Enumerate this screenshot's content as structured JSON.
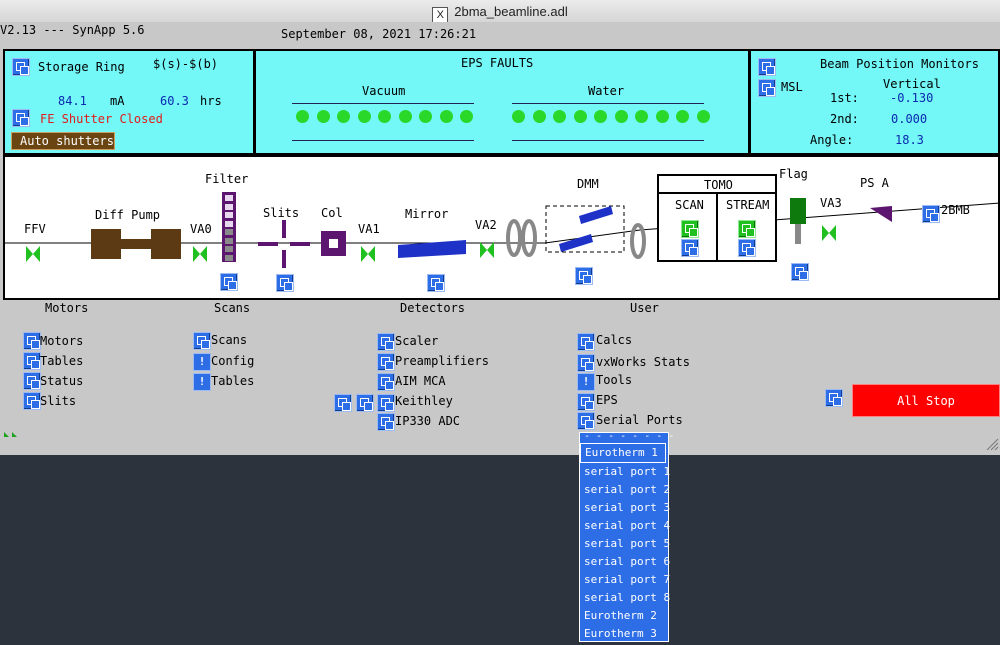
{
  "window": {
    "title": "2bma_beamline.adl"
  },
  "header": {
    "version": "V2.13 --- SynApp 5.6",
    "datetime": "September 08, 2021 17:26:21"
  },
  "storage_ring": {
    "label": "Storage Ring",
    "macro": "$(s)-$(b)",
    "current": "84.1",
    "current_unit": "mA",
    "lifetime": "60.3",
    "lifetime_unit": "hrs",
    "shutter_status": "FE Shutter Closed",
    "auto_shutters_label": "Auto shutters"
  },
  "eps": {
    "title": "EPS FAULTS",
    "vacuum_label": "Vacuum",
    "water_label": "Water",
    "vacuum_count": 9,
    "water_count": 10
  },
  "bpm": {
    "title": "Beam Position Monitors",
    "msl_label": "MSL",
    "vertical_label": "Vertical",
    "first_label": "1st:",
    "first_value": "-0.130",
    "second_label": "2nd:",
    "second_value": "0.000",
    "angle_label": "Angle:",
    "angle_value": "18.3"
  },
  "beamline": {
    "ffv": "FFV",
    "diff_pump": "Diff Pump",
    "filter": "Filter",
    "va0": "VA0",
    "slits": "Slits",
    "col": "Col",
    "va1": "VA1",
    "mirror": "Mirror",
    "va2": "VA2",
    "dmm": "DMM",
    "tomo": "TOMO",
    "scan": "SCAN",
    "stream": "STREAM",
    "flag": "Flag",
    "va3": "VA3",
    "psa": "PS A",
    "endstation": "2BMB"
  },
  "sections": {
    "motors": {
      "title": "Motors",
      "items": [
        "Motors",
        "Tables",
        "Status",
        "Slits"
      ]
    },
    "scans": {
      "title": "Scans",
      "items": [
        "Scans",
        "Config",
        "Tables"
      ]
    },
    "detectors": {
      "title": "Detectors",
      "items": [
        "Scaler",
        "Preamplifiers",
        "AIM MCA",
        "Keithley",
        "IP330 ADC"
      ]
    },
    "user": {
      "title": "User",
      "items": [
        "Calcs",
        "vxWorks Stats",
        "Tools",
        "EPS",
        "Serial Ports"
      ]
    }
  },
  "all_stop": {
    "label": "All Stop"
  },
  "serial_menu": {
    "tear": "- - - - - - - -",
    "items": [
      "Eurotherm 1",
      "serial port 1",
      "serial port 2",
      "serial port 3",
      "serial port 4",
      "serial port 5",
      "serial port 6",
      "serial port 7",
      "serial port 8",
      "Eurotherm 2",
      "Eurotherm 3"
    ]
  },
  "colors": {
    "panel": "#73f7f7",
    "led_green": "#2ad82a",
    "menu_blue": "#2d6de5",
    "alarm_red": "#ff0000",
    "shutter_red": "#e41a1a",
    "diffpump_brown": "#5c3a14",
    "filter_purple": "#5d1670",
    "valve_green": "#20c020",
    "dmm_blue": "#1f32c8"
  }
}
